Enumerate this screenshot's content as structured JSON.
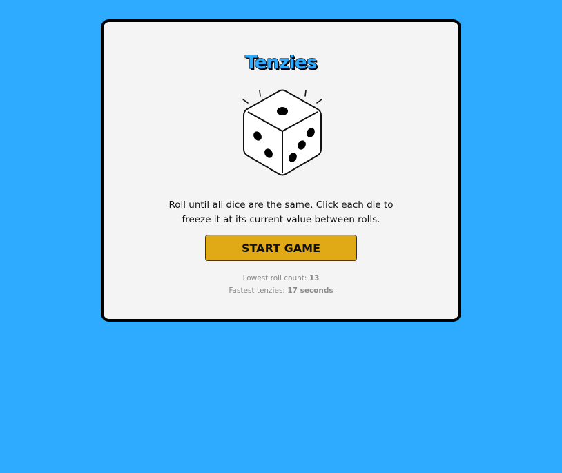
{
  "app": {
    "title": "Tenzies",
    "instructions": "Roll until all dice are the same. Click each die to freeze it at its current value between rolls.",
    "start_button_label": "START GAME",
    "hero_icon": "dice-icon"
  },
  "stats": {
    "lowest_roll_label": "Lowest roll count:",
    "lowest_roll_value": "13",
    "fastest_label": "Fastest tenzies:",
    "fastest_value": "17 seconds"
  },
  "colors": {
    "background": "#2eaaff",
    "card": "#f4f4f4",
    "title": "#2eaaff",
    "button": "#dfaa16"
  }
}
